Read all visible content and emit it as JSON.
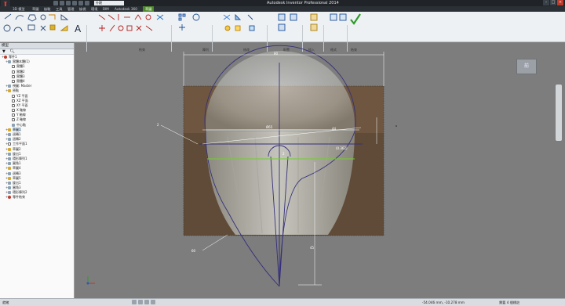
{
  "title_bar": {
    "window_title": "Autodesk Inventor Professional 2014",
    "tab_label_appearance": "外觀"
  },
  "ribbon": {
    "tabs": [
      "3D 模型",
      "草圖",
      "檢驗",
      "工具",
      "管理",
      "檢視",
      "環境",
      "BIM",
      "Autodesk 360",
      "草圖"
    ],
    "active_tab": "草圖",
    "panels": [
      "繪製",
      "約束",
      "陣列",
      "修改",
      "配置",
      "插入",
      "格式",
      "結束"
    ]
  },
  "browser": {
    "header": "模型",
    "items": [
      {
        "label": "零件1",
        "icon": "part-icon",
        "indent": 0
      },
      {
        "label": "實體本體(1)",
        "icon": "solid-icon",
        "indent": 1
      },
      {
        "label": "實體1",
        "icon": "box-icon",
        "indent": 2
      },
      {
        "label": "實體2",
        "icon": "box-icon",
        "indent": 2
      },
      {
        "label": "實體3",
        "icon": "box-icon",
        "indent": 2
      },
      {
        "label": "實體4",
        "icon": "box-icon",
        "indent": 2
      },
      {
        "label": "視圖: Master",
        "icon": "view-icon",
        "indent": 1
      },
      {
        "label": "原點",
        "icon": "folder-icon",
        "indent": 1
      },
      {
        "label": "YZ 平面",
        "icon": "plane-icon",
        "indent": 2
      },
      {
        "label": "XZ 平面",
        "icon": "plane-icon",
        "indent": 2
      },
      {
        "label": "XY 平面",
        "icon": "plane-icon",
        "indent": 2
      },
      {
        "label": "X 軸線",
        "icon": "axis-icon",
        "indent": 2
      },
      {
        "label": "Y 軸線",
        "icon": "axis-icon",
        "indent": 2
      },
      {
        "label": "Z 軸線",
        "icon": "axis-icon",
        "indent": 2
      },
      {
        "label": "中心點",
        "icon": "point-icon",
        "indent": 2
      },
      {
        "label": "草圖1",
        "icon": "sketch-icon",
        "indent": 1
      },
      {
        "label": "迴轉1",
        "icon": "revolve-icon",
        "indent": 1
      },
      {
        "label": "迴轉2",
        "icon": "revolve-icon",
        "indent": 1
      },
      {
        "label": "工作平面1",
        "icon": "plane-icon",
        "indent": 1
      },
      {
        "label": "草圖2",
        "icon": "sketch-icon",
        "indent": 1
      },
      {
        "label": "旋出1",
        "icon": "extrude-icon",
        "indent": 1
      },
      {
        "label": "環形陣列1",
        "icon": "pattern-icon",
        "indent": 1
      },
      {
        "label": "圓角1",
        "icon": "fillet-icon",
        "indent": 1
      },
      {
        "label": "草圖4",
        "icon": "sketch-icon",
        "indent": 1
      },
      {
        "label": "迴轉3",
        "icon": "revolve-icon",
        "indent": 1
      },
      {
        "label": "草圖5",
        "icon": "sketch-icon",
        "indent": 1
      },
      {
        "label": "旋出1",
        "icon": "extrude-icon",
        "indent": 1
      },
      {
        "label": "圓角3",
        "icon": "fillet-icon",
        "indent": 1
      },
      {
        "label": "環形陣列2",
        "icon": "pattern-icon",
        "indent": 1
      },
      {
        "label": "零件結束",
        "icon": "end-of-part-icon",
        "indent": 1
      }
    ]
  },
  "canvas": {
    "dimensions": {
      "overall_width": "80",
      "diameter": "Ø65",
      "ref_44": "44",
      "ref_0362": "(0.362)",
      "left_dim": "2",
      "bottom_dim": "60",
      "height_dim": "45",
      "small_r": "2"
    },
    "viewcube_label": "前"
  },
  "status_bar": {
    "ready": "就緒",
    "coords": "-54.046 mm, -10.278 mm",
    "dims_required": "需要 4 個標註"
  },
  "colors": {
    "sketch_line": "#35307a",
    "constraint_green": "#6fd02a",
    "dim_white": "#ffffff"
  }
}
